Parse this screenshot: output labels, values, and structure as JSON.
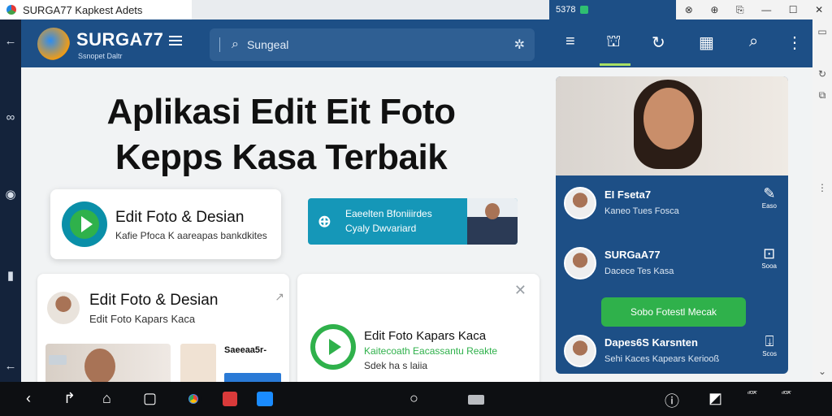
{
  "browser": {
    "tab_title": "SURGA77 Kapkest Adets",
    "right_clock": "5378",
    "window_controls": [
      "⊗",
      "⊕",
      "⎘",
      "—",
      "☐",
      "✕"
    ]
  },
  "main": {
    "brand": "SURGA77",
    "brand_sub": "Ssnopet Daltr",
    "search_placeholder": "Sungeal",
    "hero_line1": "Aplikasi Edit Eit Foto",
    "hero_line2": "Kepps Kasa Terbaik",
    "card1": {
      "title": "Edit Foto & Desian",
      "subtitle": "Kafie Pfoca K aareapas bankdkites"
    },
    "card2": {
      "line1": "Eaeelten Bfoniiirdes",
      "line2": "Cyaly Dwvariard"
    },
    "card3": {
      "title": "Edit Foto & Desian",
      "subtitle": "Edit Foto Kapars Kaca",
      "thumb_label": "Saeeaa5r-"
    },
    "card4": {
      "title": "Edit Foto Kapars Kaca",
      "green": "Kaitecoath Eacassantu Reakte",
      "sub": "Sdek ha s laiia"
    }
  },
  "right": {
    "rows": [
      {
        "title": "EI Fseta7",
        "sub": "Kaneo Tues Fosca",
        "icon_label": "Easo"
      },
      {
        "title": "SURGaA77",
        "sub": "Dacece Tes Kasa",
        "icon_label": "Sooa"
      },
      {
        "title": "Dapes6S Karsnten",
        "sub": "Sehi Kaces Kapears Keriooß",
        "icon_label": "Scos"
      }
    ],
    "green_button": "Sobo Fotestl Mecak"
  },
  "taskbar": {
    "right_labels": [
      "ᵒ̄ᴼ̄ᴬ̄",
      "ᵒ̄ᴼ̄ᴬ̄"
    ]
  }
}
